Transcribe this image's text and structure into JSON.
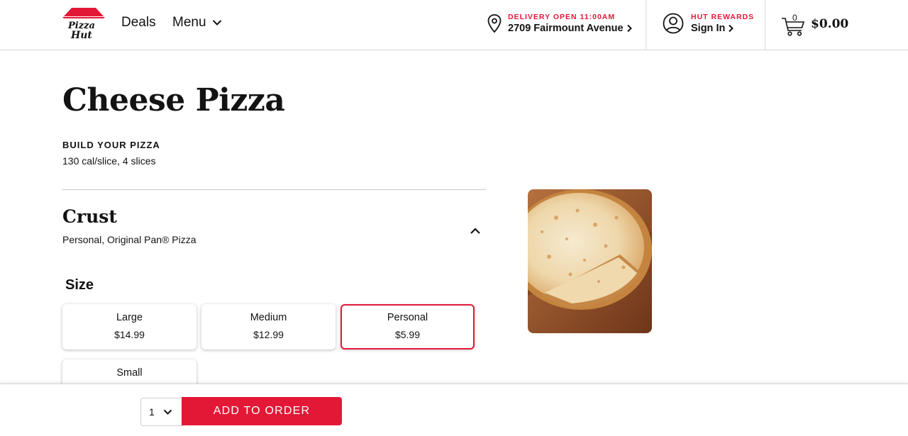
{
  "header": {
    "logo_text": "Pizza Hut",
    "nav": {
      "deals": "Deals",
      "menu": "Menu"
    },
    "delivery": {
      "status": "DELIVERY OPEN 11:00AM",
      "address": "2709 Fairmount Avenue"
    },
    "rewards": {
      "label": "HUT REWARDS",
      "sign_in": "Sign In"
    },
    "cart": {
      "count": "0",
      "total": "$0.00"
    }
  },
  "product": {
    "title": "Cheese Pizza",
    "build_label": "BUILD YOUR PIZZA",
    "calories": "130 cal/slice, 4 slices"
  },
  "crust": {
    "title": "Crust",
    "selection": "Personal, Original Pan® Pizza",
    "size_title": "Size",
    "sizes": [
      {
        "name": "Large",
        "price": "$14.99",
        "selected": false
      },
      {
        "name": "Medium",
        "price": "$12.99",
        "selected": false
      },
      {
        "name": "Personal",
        "price": "$5.99",
        "selected": true
      },
      {
        "name": "Small",
        "price": "",
        "selected": false
      }
    ]
  },
  "order": {
    "quantity": "1",
    "add_label": "ADD TO ORDER"
  },
  "colors": {
    "brand_red": "#e31837",
    "text": "#131313"
  }
}
